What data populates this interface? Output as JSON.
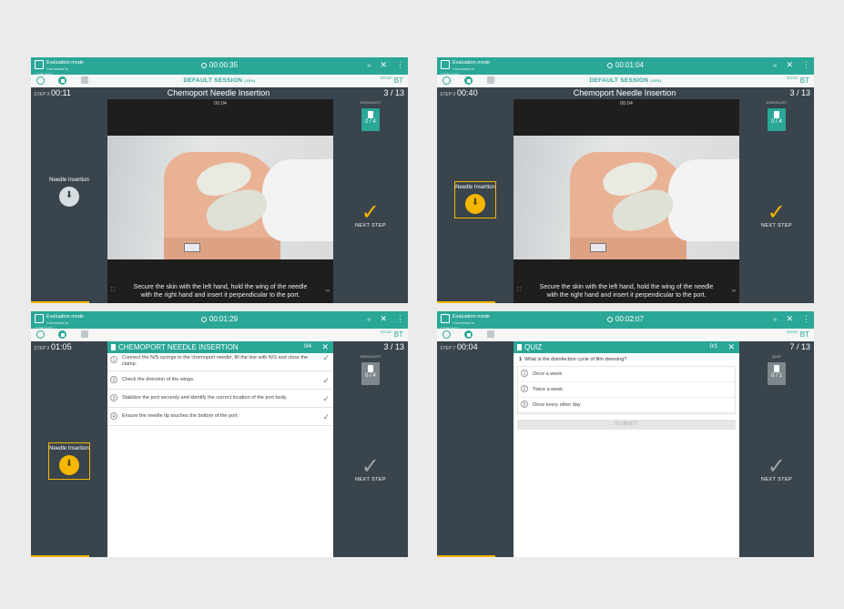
{
  "topbar": {
    "mode_title": "Evaluation mode",
    "mode_sub": "Connected to CSIPOM02",
    "icons": [
      "record-icon",
      "close-icon",
      "more-vert-icon"
    ]
  },
  "session": {
    "label": "DEFAULT SESSION",
    "pct": "(15%)",
    "group_sup": "GROUP",
    "group": "BT"
  },
  "common": {
    "checklist_label": "CHECKLIST",
    "next_step": "NEXT STEP",
    "task_label": "Needle Insertion",
    "step_title": "Chemoport Needle Insertion",
    "subtitle": "Secure the skin with the left hand, hold the wing of the needle with the right hand and insert it perpendicular to the port."
  },
  "panel1": {
    "timer": "00:00:35",
    "step_sup": "STEP 3",
    "step_time": "00:11",
    "count": "3 / 13",
    "video_time": "00:04",
    "check_count": "0 / 4"
  },
  "panel2": {
    "timer": "00:01:04",
    "step_sup": "STEP 3",
    "step_time": "00:40",
    "count": "3 / 13",
    "video_time": "00:04",
    "check_count": "0 / 4"
  },
  "panel3": {
    "timer": "00:01:29",
    "step_sup": "STEP 3",
    "step_time": "01:05",
    "count": "3 / 13",
    "check_count": "0 / 4",
    "checklist_title": "CHEMOPORT NEEDLE INSERTION",
    "checklist_count": "0/4",
    "items": [
      "Connect the N/S syringe to the chemoport needle, fill the line with N/S and close the clamp.",
      "Check the direction of the wings.",
      "Stabilize the port securely and identify the correct location of the port body.",
      "Ensure the needle tip touches the bottom of the port."
    ]
  },
  "panel4": {
    "timer": "00:02:07",
    "step_sup": "STEP 7",
    "step_time": "00:04",
    "count": "7 / 13",
    "quiz_label": "QUIZ",
    "quiz_box": "0 / 1",
    "quiz_title": "QUIZ",
    "quiz_count": "0/1",
    "question_no": "1",
    "question": "What is the disinfection cycle of film dressing?",
    "options": [
      "Once a week",
      "Twice a week",
      "Once every other day"
    ],
    "submit": "SUBMIT"
  },
  "colors": {
    "teal": "#2aa797",
    "panel": "#39444c",
    "accent": "#f5b700"
  }
}
